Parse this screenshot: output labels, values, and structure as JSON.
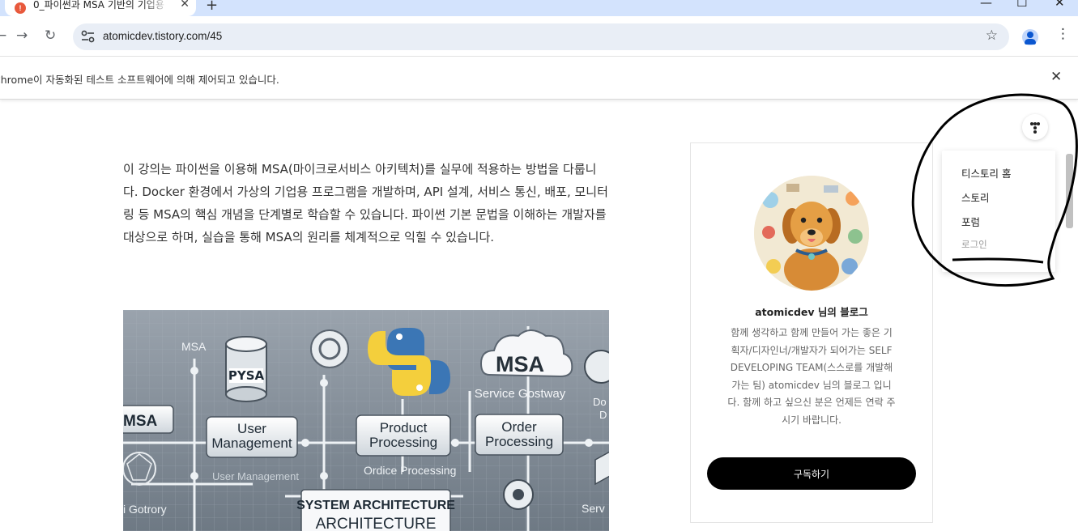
{
  "browser": {
    "tab_title": "0_파이썬과 MSA 기반의 기업용",
    "tab_favicon": "!",
    "close_glyph": "✕",
    "new_tab_glyph": "+",
    "minimize_glyph": "—",
    "maximize_glyph": "☐",
    "back_glyph": "←",
    "forward_glyph": "→",
    "reload_glyph": "↻",
    "url": "atomicdev.tistory.com/45",
    "star_glyph": "☆",
    "menu_glyph": "⋮",
    "automation_notice": "Chrome이 자동화된 테스트 소프트웨어에 의해 제어되고 있습니다."
  },
  "article": {
    "intro": "이 강의는 파이썬을 이용해 MSA(마이크로서비스 아키텍처)를 실무에 적용하는 방법을 다룹니다. Docker 환경에서 가상의 기업용 프로그램을 개발하며, API 설계, 서비스 통신, 배포, 모니터링 등 MSA의 핵심 개념을 단계별로 학습할 수 있습니다. 파이썬 기본 문법을 이해하는 개발자를 대상으로 하며, 실습을 통해 MSA의 원리를 체계적으로 익힐 수 있습니다."
  },
  "hero": {
    "msa_small": "MSA",
    "msa_left": "MSA",
    "pysa": "PYSA",
    "msa_cloud": "MSA",
    "service_gateway": "Service Gostway",
    "user_management": "User Management",
    "product_processing": "Product Processing",
    "order_processing": "Order Processing",
    "user_management_ghost": "User Management",
    "order_processing_ghost": "Ordice Processing",
    "gotrory": "i Gotrory",
    "system_arch_1": "SYSTEM ARCHITECTURE",
    "system_arch_2": "ARCHITECTURE",
    "do": "Do",
    "d": "D",
    "serv": "Serv"
  },
  "sidebar": {
    "blog_name": "atomicdev 님의 블로그",
    "description": "함께 생각하고 함께 만들어 가는 좋은 기획자/디자인너/개발자가 되어가는 SELF DEVELOPING TEAM(스스로를 개발해 가는 팀) atomicdev 님의 블로그 입니다. 함께 하고 싶으신 분은 언제든 연락 주시기 바랍니다.",
    "subscribe_label": "구독하기"
  },
  "menu": {
    "items": [
      {
        "label": "티스토리 홈"
      },
      {
        "label": "스토리"
      },
      {
        "label": "포럼"
      },
      {
        "label": "로그인"
      }
    ]
  },
  "colors": {
    "tabstrip": "#d3e3fd",
    "omnibox": "#e9eef6",
    "accent": "#0b57d0",
    "subscribe_bg": "#000000"
  },
  "icons": {
    "favicon": "tistory-favicon-icon",
    "site_info": "tune-icon",
    "profile": "profile-icon",
    "menu_toggle": "dots-menu-icon"
  }
}
